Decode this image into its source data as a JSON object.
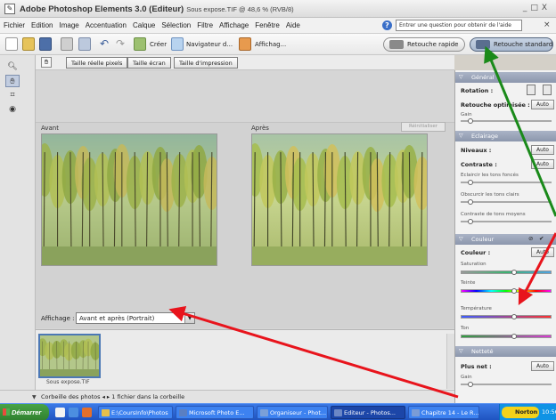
{
  "window": {
    "title": "Adobe Photoshop Elements 3.0 (Editeur)",
    "subtitle": "Sous expose.TIF @ 48,6 % (RVB/8)",
    "min_label": "_",
    "max_label": "□",
    "close_label": "X"
  },
  "menu": {
    "items": [
      "Fichier",
      "Edition",
      "Image",
      "Accentuation",
      "Calque",
      "Sélection",
      "Filtre",
      "Affichage",
      "Fenêtre",
      "Aide"
    ],
    "help_placeholder": "Entrer une question pour obtenir de l'aide",
    "close_label": "×"
  },
  "shortcuts": {
    "create_label": "Créer",
    "browser_label": "Navigateur d...",
    "view_label": "Affichag...",
    "quick_fix_label": "Retouche rapide",
    "standard_edit_label": "Retouche standard"
  },
  "options": {
    "actual_pixels": "Taille réelle pixels",
    "fit_screen": "Taille écran",
    "print_size": "Taille d'impression"
  },
  "canvas": {
    "before_label": "Avant",
    "after_label": "Après",
    "reset_label": "Réinitialiser",
    "view_label": "Affichage :",
    "view_value": "Avant et après (Portrait)"
  },
  "bin": {
    "thumb_caption": "Sous expose.TIF",
    "footer_text": "Corbeille des photos",
    "footer_count": "1 fichier dans la corbeille"
  },
  "palette": {
    "general": {
      "header": "Général",
      "rotation_label": "Rotation :",
      "smart_fix_label": "Retouche optimisée :",
      "auto_label": "Auto",
      "amount_label": "Gain"
    },
    "lighting": {
      "header": "Eclairage",
      "levels_label": "Niveaux :",
      "contrast_label": "Contraste :",
      "auto_label": "Auto",
      "shadows_label": "Eclaircir les tons foncés",
      "highlights_label": "Obscurcir les tons clairs",
      "midtone_label": "Contraste de tons moyens"
    },
    "color": {
      "header": "Couleur",
      "color_label": "Couleur :",
      "auto_label": "Auto",
      "saturation_label": "Saturation",
      "hue_label": "Teinte",
      "temperature_label": "Température",
      "tint_label": "Ton"
    },
    "sharpen": {
      "header": "Netteté",
      "sharpen_label": "Plus net :",
      "auto_label": "Auto",
      "amount_label": "Gain"
    }
  },
  "taskbar": {
    "start_label": "Démarrer",
    "tasks": [
      "E:\\CoursInfo\\Photos",
      "Microsoft Photo E...",
      "Organiseur - Phot...",
      "Editeur - Photos...",
      "Chapitre 14 - Le R..."
    ],
    "norton_label": "Norton",
    "clock": "10:56"
  },
  "colors": {
    "palette_header": "#8c97ad",
    "taskbar": "#245edb",
    "arrow_green": "#1a8a1a",
    "arrow_red": "#e8141c"
  }
}
